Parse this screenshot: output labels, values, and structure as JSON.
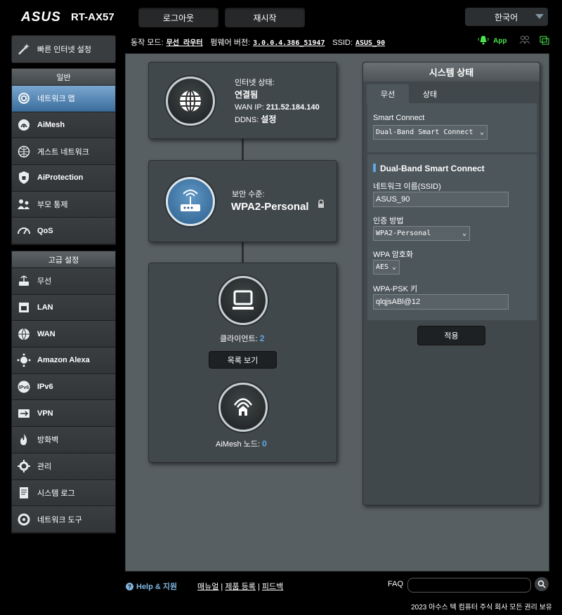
{
  "header": {
    "brand": "ASUS",
    "model": "RT-AX57",
    "logout_label": "로그아웃",
    "restart_label": "재시작",
    "language": "한국어"
  },
  "status_bar": {
    "mode_label": "동작 모드:",
    "mode_value": "무선 라우터",
    "fw_label": "펌웨어 버전:",
    "fw_value": "3.0.0.4.386_51947",
    "ssid_label": "SSID:",
    "ssid_value": "ASUS_90",
    "app_label": "App"
  },
  "sidebar": {
    "quick_setup": "빠른 인터넷 설정",
    "general_title": "일반",
    "general_items": [
      {
        "label": "네트워크 맵",
        "icon": "network-map-icon"
      },
      {
        "label": "AiMesh",
        "icon": "aimesh-icon"
      },
      {
        "label": "게스트 네트워크",
        "icon": "guest-network-icon"
      },
      {
        "label": "AiProtection",
        "icon": "aiprotection-icon"
      },
      {
        "label": "부모 통제",
        "icon": "parental-control-icon"
      },
      {
        "label": "QoS",
        "icon": "qos-icon"
      }
    ],
    "advanced_title": "고급 설정",
    "advanced_items": [
      {
        "label": "무선",
        "icon": "wireless-icon"
      },
      {
        "label": "LAN",
        "icon": "lan-icon"
      },
      {
        "label": "WAN",
        "icon": "wan-icon"
      },
      {
        "label": "Amazon Alexa",
        "icon": "alexa-icon"
      },
      {
        "label": "IPv6",
        "icon": "ipv6-icon"
      },
      {
        "label": "VPN",
        "icon": "vpn-icon"
      },
      {
        "label": "방화벽",
        "icon": "firewall-icon"
      },
      {
        "label": "관리",
        "icon": "administration-icon"
      },
      {
        "label": "시스템 로그",
        "icon": "system-log-icon"
      },
      {
        "label": "네트워크 도구",
        "icon": "network-tools-icon"
      }
    ]
  },
  "map": {
    "internet_status_label": "인터넷 상태:",
    "internet_status_value": "연결됨",
    "wan_ip_label": "WAN IP:",
    "wan_ip_value": "211.52.184.140",
    "ddns_label": "DDNS:",
    "ddns_value": "설정",
    "security_label": "보안 수준:",
    "security_value": "WPA2-Personal",
    "clients_label": "클라이언트:",
    "clients_value": "2",
    "view_list_label": "목록 보기",
    "aimesh_label": "AiMesh 노드:",
    "aimesh_value": "0"
  },
  "system_status": {
    "title": "시스템 상태",
    "tabs": [
      "무선",
      "상태"
    ],
    "smart_connect_label": "Smart Connect",
    "smart_connect_value": "Dual-Band Smart Connect",
    "section_title": "Dual-Band Smart Connect",
    "ssid_label": "네트워크 이름(SSID)",
    "ssid_value": "ASUS_90",
    "auth_label": "인증 방법",
    "auth_value": "WPA2-Personal",
    "enc_label": "WPA 암호화",
    "enc_value": "AES",
    "psk_label": "WPA-PSK 키",
    "psk_value": "qlqjsABl@12",
    "apply_label": "적용"
  },
  "footer": {
    "help_label": "Help & 지원",
    "manual": "매뉴얼",
    "register": "제품 등록",
    "feedback": "피드백",
    "faq_label": "FAQ",
    "copyright": "2023 아수스 텍 컴퓨터 주식 회사 모든 권리 보유"
  },
  "colors": {
    "accent": "#5fa7e0",
    "app_green": "#4ce34c",
    "active_menu": "#3a6c9c"
  }
}
